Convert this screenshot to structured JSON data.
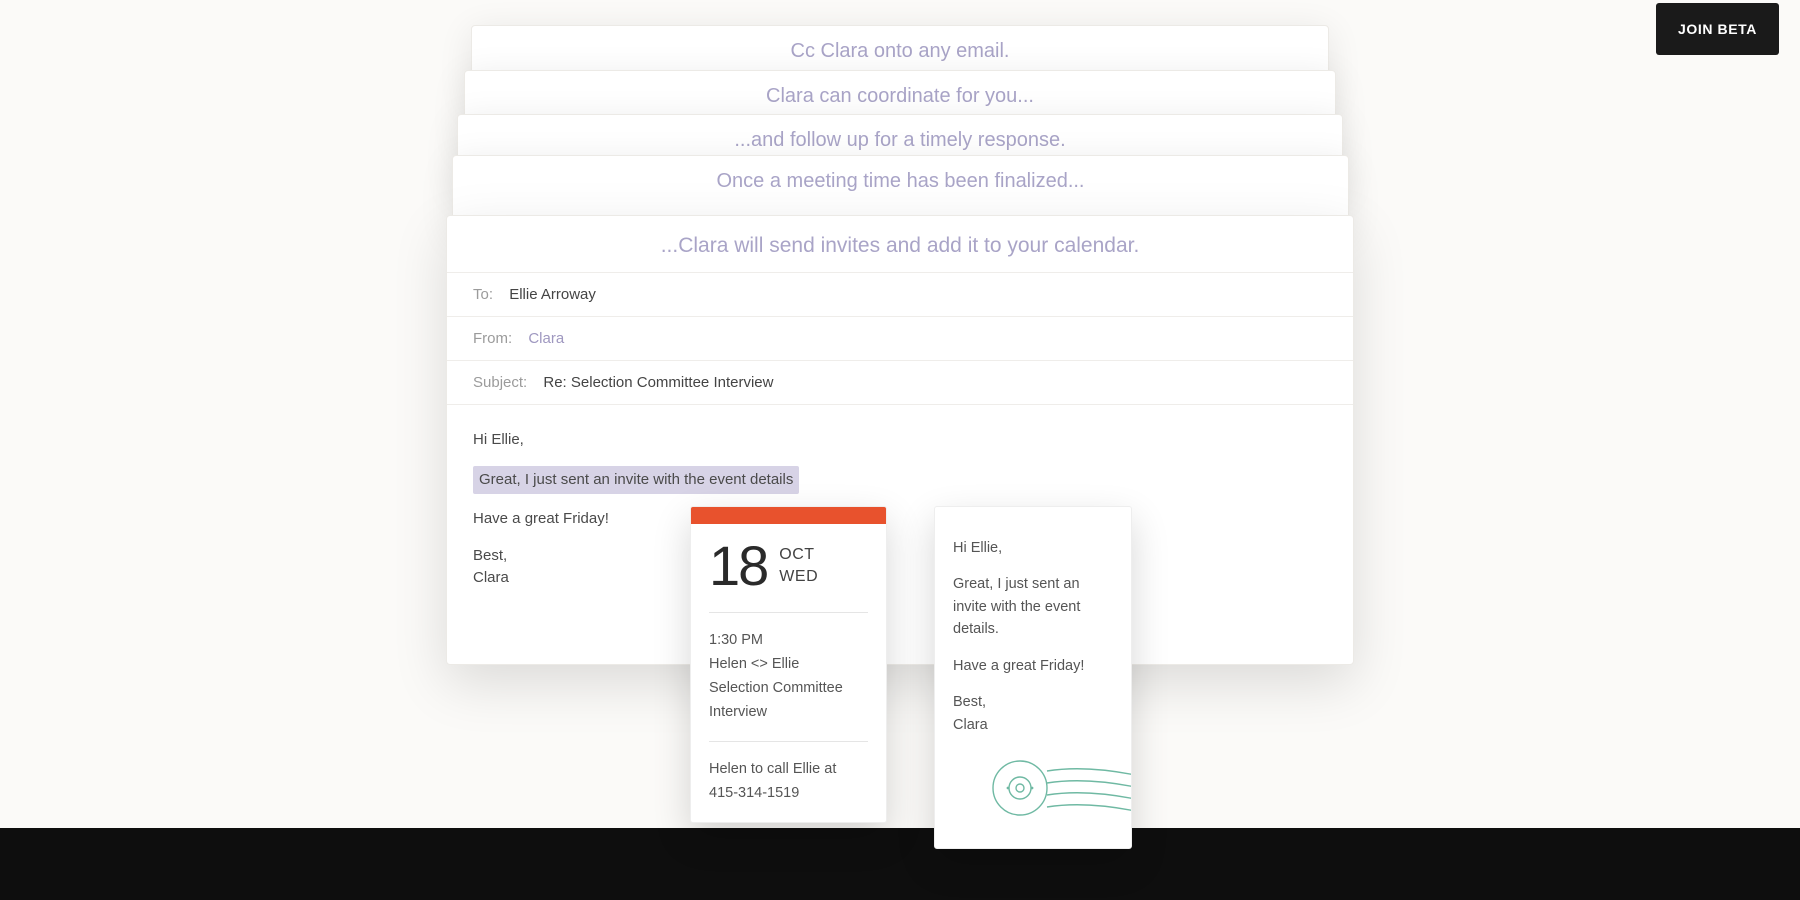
{
  "cta": {
    "join_beta": "JOIN BETA"
  },
  "stack": {
    "line1": "Cc Clara onto any email.",
    "line2": "Clara can coordinate for you...",
    "line3": "...and follow up for a timely response.",
    "line4": "Once a meeting time has been finalized..."
  },
  "email": {
    "headline": "...Clara will send invites and add it to your calendar.",
    "to_label": "To:",
    "to_value": "Ellie Arroway",
    "from_label": "From:",
    "from_value": "Clara",
    "subject_label": "Subject:",
    "subject_value": "Re: Selection Committee Interview",
    "greeting": "Hi Ellie,",
    "highlight": "Great, I just sent an invite with the event details",
    "line3": "Have a great Friday!",
    "signoff1": "Best,",
    "signoff2": "Clara"
  },
  "calendar": {
    "accent_color": "#e8522d",
    "day_num": "18",
    "month": "OCT",
    "weekday": "WED",
    "time": "1:30 PM",
    "title": "Helen <> Ellie",
    "desc": "Selection Committee Interview",
    "note_line1": "Helen to call Ellie at",
    "note_line2": "415-314-1519"
  },
  "note": {
    "greeting": "Hi Ellie,",
    "body": "Great, I just sent an invite with the event details.",
    "line3": "Have a great Friday!",
    "signoff1": "Best,",
    "signoff2": "Clara",
    "stamp_color": "#6fb9a3"
  }
}
